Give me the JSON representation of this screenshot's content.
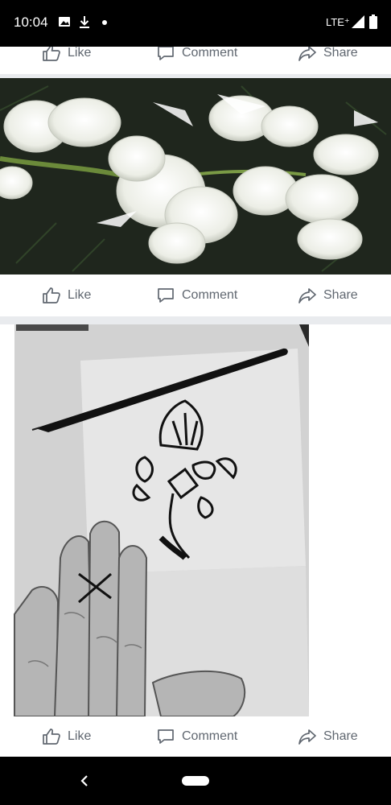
{
  "status_bar": {
    "time": "10:04",
    "network": "LTE⁺",
    "icons": [
      "image-notification-icon",
      "download-icon",
      "dot-icon",
      "signal-icon",
      "battery-icon"
    ]
  },
  "posts": [
    {
      "actions": {
        "like": "Like",
        "comment": "Comment",
        "share": "Share"
      }
    },
    {
      "photo": "white tuberose flowers",
      "actions": {
        "like": "Like",
        "comment": "Comment",
        "share": "Share"
      }
    },
    {
      "photo": "flower tattoo sketch with pen and hand",
      "actions": {
        "like": "Like",
        "comment": "Comment",
        "share": "Share"
      }
    }
  ],
  "nav_bar": {
    "icons": [
      "back-icon",
      "home-pill-icon"
    ]
  },
  "colors": {
    "action_text": "#606770",
    "feed_bg": "#e9ebee",
    "bar_bg": "#000000"
  }
}
